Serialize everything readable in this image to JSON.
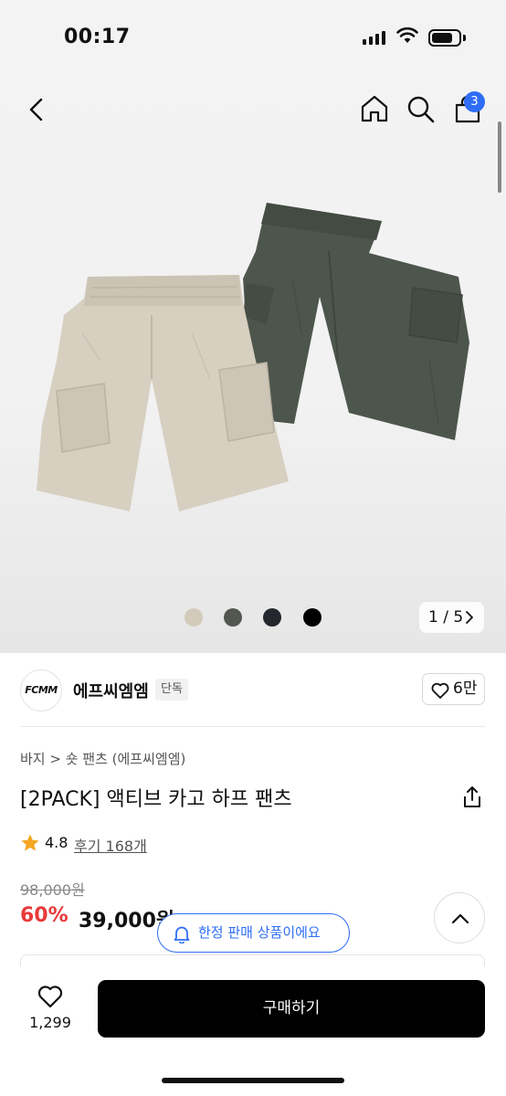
{
  "status_bar": {
    "time": "00:17"
  },
  "header": {
    "cart_badge": "3"
  },
  "gallery": {
    "colors": [
      "#d2cbbb",
      "#535750",
      "#24272e",
      "#000000"
    ],
    "pager_text": "1 / 5",
    "short_colors": {
      "beige": "#d7cfc0",
      "green": "#4d564c"
    }
  },
  "brand": {
    "logo_text": "FCMM",
    "name": "에프씨엠엠",
    "tag": "단독",
    "likes": "6만"
  },
  "product": {
    "breadcrumb": "바지 > 숏 팬츠 (에프씨엠엠)",
    "title": "[2PACK] 액티브 카고 하프 팬츠",
    "rating": "4.8",
    "review_link": "후기 168개",
    "original_price": "98,000원",
    "discount": "60%",
    "sale_price": "39,000원"
  },
  "toast": {
    "text": "한정 판매 상품이에요"
  },
  "bottom_bar": {
    "wish_count": "1,299",
    "buy_label": "구매하기"
  },
  "accent_colors": {
    "blue": "#2f6df6",
    "red": "#e83a3a",
    "star": "#f5a623"
  }
}
